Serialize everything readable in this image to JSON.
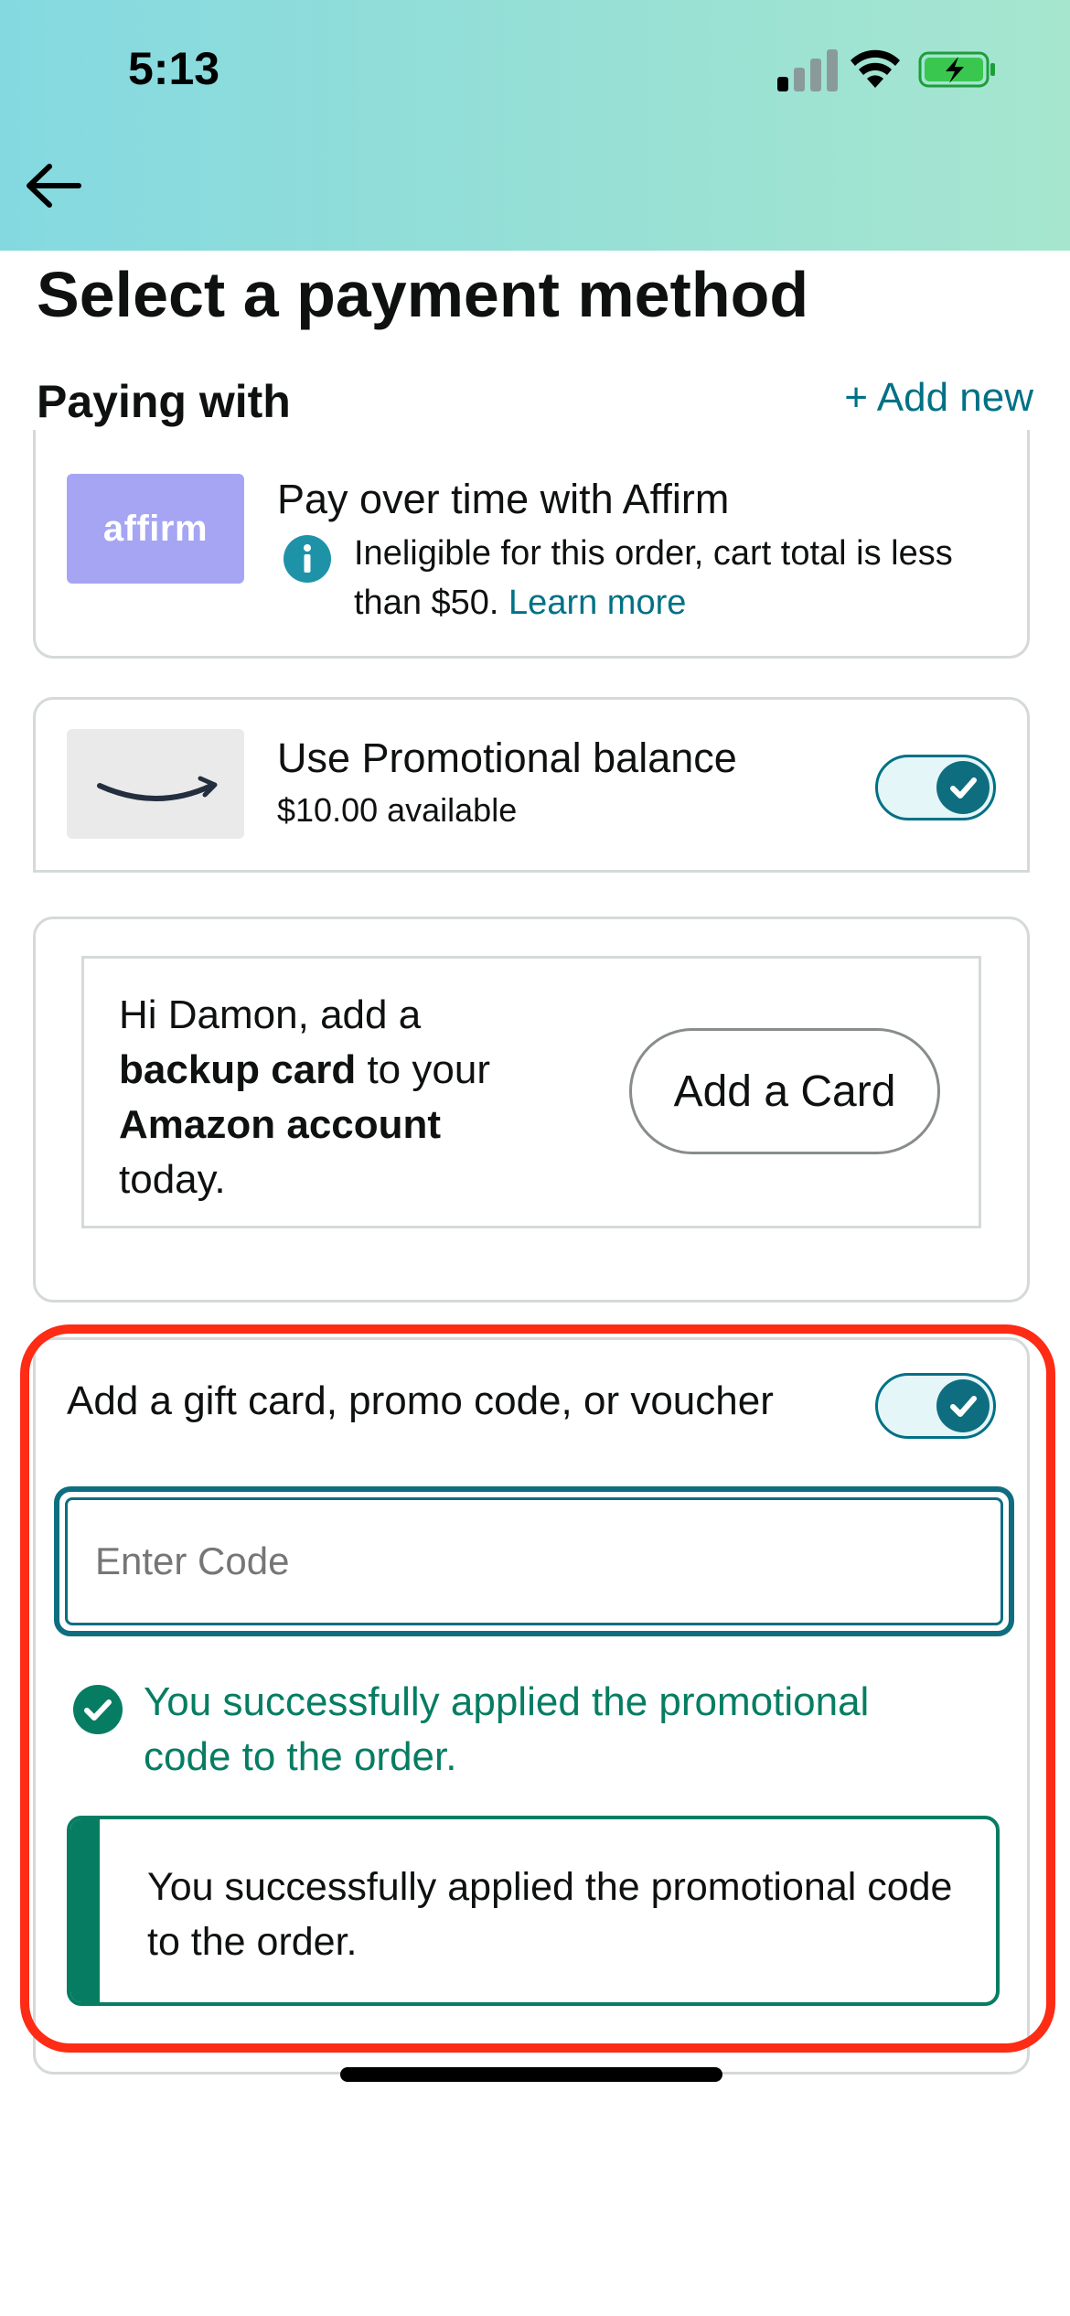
{
  "status_bar": {
    "time": "5:13",
    "icons": [
      "cellular-signal-icon",
      "wifi-icon",
      "battery-charging-icon"
    ]
  },
  "header": {
    "back_icon": "arrow-left-icon",
    "title": "Select a payment method"
  },
  "paying_with": {
    "title": "Paying with",
    "add_new": "+ Add new"
  },
  "affirm": {
    "logo_text": "affirm",
    "title": "Pay over time with Affirm",
    "note": "Ineligible for this order, cart total is less than $50.",
    "learn_more": "Learn more"
  },
  "promotional_balance": {
    "title": "Use Promotional balance",
    "available": "$10.00 available",
    "enabled": true
  },
  "backup_card": {
    "line1": "Hi Damon, add a",
    "bold1": "backup card",
    "line2": "to your",
    "bold2": "Amazon account",
    "line3": "today.",
    "button": "Add a Card"
  },
  "gift_card": {
    "title": "Add a gift card, promo code, or voucher",
    "enabled": true,
    "placeholder": "Enter Code",
    "success_message": "You successfully applied the promotional code to the order.",
    "alert_message": "You successfully applied the promotional code to the order."
  },
  "colors": {
    "link": "#007185",
    "success": "#067d62",
    "toggle": "#0e6e80",
    "highlight": "#fe2b15",
    "affirm_brand": "#a5a5f4"
  }
}
